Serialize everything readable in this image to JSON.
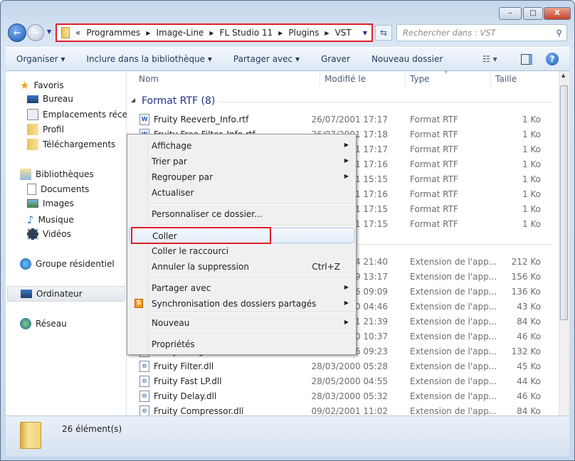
{
  "window": {
    "controls": {
      "minimize": "–",
      "maximize": "□",
      "close": "X"
    }
  },
  "address": {
    "overflow": "«",
    "crumbs": [
      "Programmes",
      "Image-Line",
      "FL Studio 11",
      "Plugins",
      "VST"
    ]
  },
  "search": {
    "placeholder": "Rechercher dans : VST"
  },
  "toolbar": {
    "organize": "Organiser ▾",
    "include": "Inclure dans la bibliothèque ▾",
    "share": "Partager avec ▾",
    "burn": "Graver",
    "new_folder": "Nouveau dossier"
  },
  "sidebar": {
    "favorites": {
      "label": "Favoris",
      "items": [
        "Bureau",
        "Emplacements récents",
        "Profil",
        "Téléchargements"
      ]
    },
    "libraries": {
      "label": "Bibliothèques",
      "items": [
        "Documents",
        "Images",
        "Musique",
        "Vidéos"
      ]
    },
    "homegroup": "Groupe résidentiel",
    "computer": "Ordinateur",
    "network": "Réseau"
  },
  "columns": {
    "name": "Nom",
    "modified": "Modifié le",
    "type": "Type",
    "size": "Taille"
  },
  "groups": [
    {
      "label": "Format RTF (8)",
      "rows": [
        {
          "name": "Fruity Reeverb_Info.rtf",
          "date": "26/07/2001 17:17",
          "type": "Format RTF",
          "size": "1 Ko"
        },
        {
          "name": "Fruity Free Filter_Info.rtf",
          "date": "26/07/2001 17:18",
          "type": "Format RTF",
          "size": "1 Ko"
        },
        {
          "name": "",
          "date": "01 17:17",
          "type": "Format RTF",
          "size": "1 Ko"
        },
        {
          "name": "",
          "date": "01 17:16",
          "type": "Format RTF",
          "size": "1 Ko"
        },
        {
          "name": "",
          "date": "01 15:15",
          "type": "Format RTF",
          "size": "1 Ko"
        },
        {
          "name": "",
          "date": "01 17:16",
          "type": "Format RTF",
          "size": "1 Ko"
        },
        {
          "name": "",
          "date": "01 17:15",
          "type": "Format RTF",
          "size": "1 Ko"
        },
        {
          "name": "",
          "date": "01 17:15",
          "type": "Format RTF",
          "size": "1 Ko"
        }
      ]
    },
    {
      "label": "",
      "rows": [
        {
          "name": "",
          "date": "14 21:40",
          "type": "Extension de l'app...",
          "size": "212 Ko"
        },
        {
          "name": "",
          "date": "09 13:17",
          "type": "Extension de l'app...",
          "size": "156 Ko"
        },
        {
          "name": "",
          "date": "06 09:09",
          "type": "Extension de l'app...",
          "size": "136 Ko"
        },
        {
          "name": "",
          "date": "00 04:46",
          "type": "Extension de l'app...",
          "size": "43 Ko"
        },
        {
          "name": "",
          "date": "01 21:39",
          "type": "Extension de l'app...",
          "size": "84 Ko"
        },
        {
          "name": "",
          "date": "00 10:37",
          "type": "Extension de l'app...",
          "size": "46 Ko"
        },
        {
          "name": "Fruity Flanger.dll",
          "date": "06 09:23",
          "type": "Extension de l'app...",
          "size": "132 Ko"
        },
        {
          "name": "Fruity Filter.dll",
          "date": "28/03/2000 05:28",
          "type": "Extension de l'app...",
          "size": "45 Ko"
        },
        {
          "name": "Fruity Fast LP.dll",
          "date": "28/05/2000 04:55",
          "type": "Extension de l'app...",
          "size": "44 Ko"
        },
        {
          "name": "Fruity Delay.dll",
          "date": "28/03/2000 05:32",
          "type": "Extension de l'app...",
          "size": "46 Ko"
        },
        {
          "name": "Fruity Compressor.dll",
          "date": "09/02/2001 11:02",
          "type": "Extension de l'app...",
          "size": "84 Ko"
        }
      ]
    }
  ],
  "context_menu": {
    "items": [
      {
        "label": "Affichage",
        "submenu": true
      },
      {
        "label": "Trier par",
        "submenu": true
      },
      {
        "label": "Regrouper par",
        "submenu": true
      },
      {
        "label": "Actualiser"
      },
      {
        "label": "Personnaliser ce dossier..."
      },
      {
        "label": "Coller",
        "highlighted": true
      },
      {
        "label": "Coller le raccourci"
      },
      {
        "label": "Annuler la suppression",
        "shortcut": "Ctrl+Z"
      },
      {
        "label": "Partager avec",
        "submenu": true
      },
      {
        "label": "Synchronisation des dossiers partagés",
        "submenu": true,
        "icon": "S"
      },
      {
        "label": "Nouveau",
        "submenu": true
      },
      {
        "label": "Propriétés"
      }
    ]
  },
  "status": {
    "count": "26 élément(s)"
  },
  "colors": {
    "highlight": "#e0202a",
    "group_header": "#1e3287",
    "accent": "#1b5bb8"
  }
}
